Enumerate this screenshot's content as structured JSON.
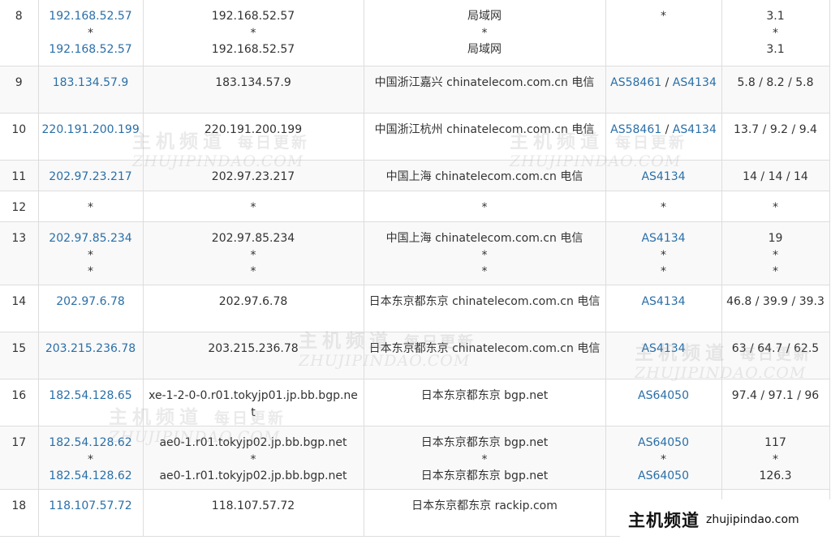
{
  "rows": [
    {
      "hop": "8",
      "ips": [
        "192.168.52.57",
        "*",
        "192.168.52.57"
      ],
      "host": [
        "192.168.52.57",
        "*",
        "192.168.52.57"
      ],
      "geo": [
        "局域网",
        "*",
        "局域网"
      ],
      "as": [
        "*"
      ],
      "time": [
        "3.1",
        "*",
        "3.1"
      ]
    },
    {
      "hop": "9",
      "ips": [
        "183.134.57.9"
      ],
      "host": [
        "183.134.57.9"
      ],
      "geo": [
        "中国浙江嘉兴 chinatelecom.com.cn 电信"
      ],
      "as": [
        "AS58461 / AS4134"
      ],
      "time": [
        "5.8 / 8.2 / 5.8"
      ]
    },
    {
      "hop": "10",
      "ips": [
        "220.191.200.199"
      ],
      "host": [
        "220.191.200.199"
      ],
      "geo": [
        "中国浙江杭州 chinatelecom.com.cn 电信"
      ],
      "as": [
        "AS58461 / AS4134"
      ],
      "time": [
        "13.7 / 9.2 / 9.4"
      ]
    },
    {
      "hop": "11",
      "ips": [
        "202.97.23.217"
      ],
      "host": [
        "202.97.23.217"
      ],
      "geo": [
        "中国上海 chinatelecom.com.cn 电信"
      ],
      "as": [
        "AS4134"
      ],
      "time": [
        "14 / 14 / 14"
      ]
    },
    {
      "hop": "12",
      "ips": [
        "*"
      ],
      "host": [
        "*"
      ],
      "geo": [
        "*"
      ],
      "as": [
        "*"
      ],
      "time": [
        "*"
      ]
    },
    {
      "hop": "13",
      "ips": [
        "202.97.85.234",
        "*",
        "*"
      ],
      "host": [
        "202.97.85.234",
        "*",
        "*"
      ],
      "geo": [
        "中国上海 chinatelecom.com.cn 电信",
        "*",
        "*"
      ],
      "as": [
        "AS4134",
        "*",
        "*"
      ],
      "time": [
        "19",
        "*",
        "*"
      ]
    },
    {
      "hop": "14",
      "ips": [
        "202.97.6.78"
      ],
      "host": [
        "202.97.6.78"
      ],
      "geo": [
        "日本东京都东京 chinatelecom.com.cn 电信"
      ],
      "as": [
        "AS4134"
      ],
      "time": [
        "46.8 / 39.9 / 39.3"
      ]
    },
    {
      "hop": "15",
      "ips": [
        "203.215.236.78"
      ],
      "host": [
        "203.215.236.78"
      ],
      "geo": [
        "日本东京都东京 chinatelecom.com.cn 电信"
      ],
      "as": [
        "AS4134"
      ],
      "time": [
        "63 / 64.7 / 62.5"
      ]
    },
    {
      "hop": "16",
      "ips": [
        "182.54.128.65"
      ],
      "host": [
        "xe-1-2-0-0.r01.tokyjp01.jp.bb.bgp.net"
      ],
      "geo": [
        "日本东京都东京 bgp.net"
      ],
      "as": [
        "AS64050"
      ],
      "time": [
        "97.4 / 97.1 / 96"
      ]
    },
    {
      "hop": "17",
      "ips": [
        "182.54.128.62",
        "*",
        "182.54.128.62"
      ],
      "host": [
        "ae0-1.r01.tokyjp02.jp.bb.bgp.net",
        "*",
        "ae0-1.r01.tokyjp02.jp.bb.bgp.net"
      ],
      "geo": [
        "日本东京都东京 bgp.net",
        "*",
        "日本东京都东京 bgp.net"
      ],
      "as": [
        "AS64050",
        "*",
        "AS64050"
      ],
      "time": [
        "117",
        "*",
        "126.3"
      ]
    },
    {
      "hop": "18",
      "ips": [
        "118.107.57.72"
      ],
      "host": [
        "118.107.57.72"
      ],
      "geo": [
        "日本东京都东京 rackip.com"
      ],
      "as": [
        ""
      ],
      "time": [
        ""
      ]
    }
  ],
  "watermark": {
    "cn": "主机频道",
    "cn_sub": "每日更新",
    "en": "ZHUJIPINDAO.COM"
  },
  "logo": {
    "cn": "主机频道",
    "url": "zhujipindao.com"
  },
  "colors": {
    "link": "#2a6fa8",
    "border": "#dddddd",
    "row_alt": "#f9f9f9",
    "text": "#333333"
  }
}
